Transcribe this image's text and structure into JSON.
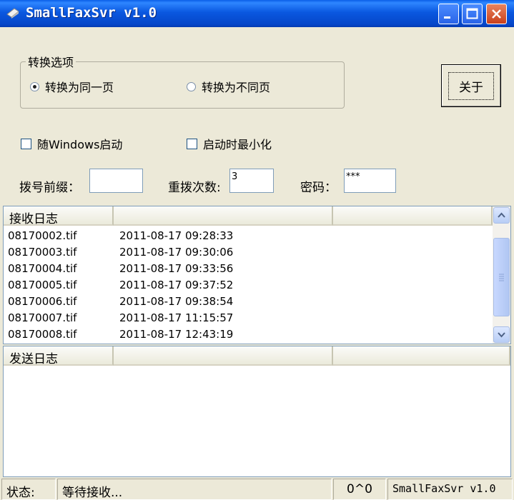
{
  "window": {
    "title": "SmallFaxSvr v1.0"
  },
  "options": {
    "group_label": "转换选项",
    "radio_same": "转换为同一页",
    "radio_diff": "转换为不同页",
    "selected": "same"
  },
  "buttons": {
    "close_label": "关于"
  },
  "checks": {
    "start_with_windows": "随Windows启动",
    "minimize_on_start": "启动时最小化"
  },
  "fields": {
    "prefix_label": "拨号前缀：",
    "prefix_value": "",
    "redial_label": "重拨次数:",
    "redial_value": "3",
    "password_label": "密码：",
    "password_value": "***"
  },
  "receive_log": {
    "header": "接收日志",
    "rows": [
      {
        "file": "08170002.tif",
        "time": "2011-08-17 09:28:33"
      },
      {
        "file": "08170003.tif",
        "time": "2011-08-17 09:30:06"
      },
      {
        "file": "08170004.tif",
        "time": "2011-08-17 09:33:56"
      },
      {
        "file": "08170005.tif",
        "time": "2011-08-17 09:37:52"
      },
      {
        "file": "08170006.tif",
        "time": "2011-08-17 09:38:54"
      },
      {
        "file": "08170007.tif",
        "time": "2011-08-17 11:15:57"
      },
      {
        "file": "08170008.tif",
        "time": "2011-08-17 12:43:19"
      }
    ]
  },
  "send_log": {
    "header": "发送日志"
  },
  "statusbar": {
    "label": "状态:",
    "message": "等待接收...",
    "counter": "0^0",
    "app_name": "SmallFaxSvr v1.0"
  },
  "colors": {
    "titlebar": "#0a58e0",
    "close_button": "#c9401c",
    "window_bg": "#ece9d8"
  }
}
